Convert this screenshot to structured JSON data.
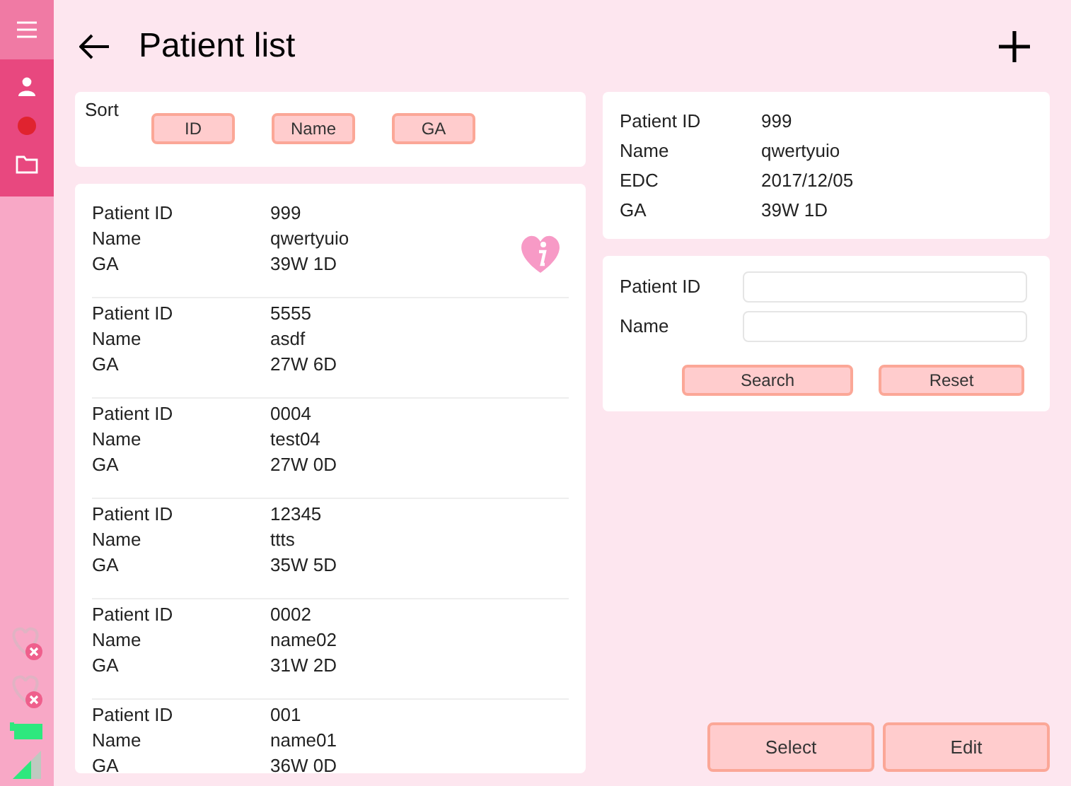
{
  "header": {
    "title": "Patient list"
  },
  "sort": {
    "label": "Sort",
    "buttons": [
      "ID",
      "Name",
      "GA"
    ]
  },
  "patients": [
    {
      "fields": [
        {
          "label": "Patient ID",
          "value": "999"
        },
        {
          "label": "Name",
          "value": "qwertyuio"
        },
        {
          "label": "GA",
          "value": "39W 1D"
        }
      ],
      "selected": true
    },
    {
      "fields": [
        {
          "label": "Patient ID",
          "value": "5555"
        },
        {
          "label": "Name",
          "value": "asdf"
        },
        {
          "label": "GA",
          "value": "27W 6D"
        }
      ],
      "selected": false
    },
    {
      "fields": [
        {
          "label": "Patient ID",
          "value": "0004"
        },
        {
          "label": "Name",
          "value": "test04"
        },
        {
          "label": "GA",
          "value": "27W 0D"
        }
      ],
      "selected": false
    },
    {
      "fields": [
        {
          "label": "Patient ID",
          "value": "12345"
        },
        {
          "label": "Name",
          "value": "ttts"
        },
        {
          "label": "GA",
          "value": "35W 5D"
        }
      ],
      "selected": false
    },
    {
      "fields": [
        {
          "label": "Patient ID",
          "value": "0002"
        },
        {
          "label": "Name",
          "value": "name02"
        },
        {
          "label": "GA",
          "value": "31W 2D"
        }
      ],
      "selected": false
    },
    {
      "fields": [
        {
          "label": "Patient ID",
          "value": "001"
        },
        {
          "label": "Name",
          "value": "name01"
        },
        {
          "label": "GA",
          "value": "36W 0D"
        }
      ],
      "selected": false
    }
  ],
  "detail": [
    {
      "label": "Patient ID",
      "value": "999"
    },
    {
      "label": "Name",
      "value": "qwertyuio"
    },
    {
      "label": "EDC",
      "value": "2017/12/05"
    },
    {
      "label": "GA",
      "value": "39W 1D"
    }
  ],
  "search": {
    "fields": [
      {
        "label": "Patient ID"
      },
      {
        "label": "Name"
      }
    ],
    "buttons": [
      "Search",
      "Reset"
    ]
  },
  "actions": [
    "Select",
    "Edit"
  ]
}
